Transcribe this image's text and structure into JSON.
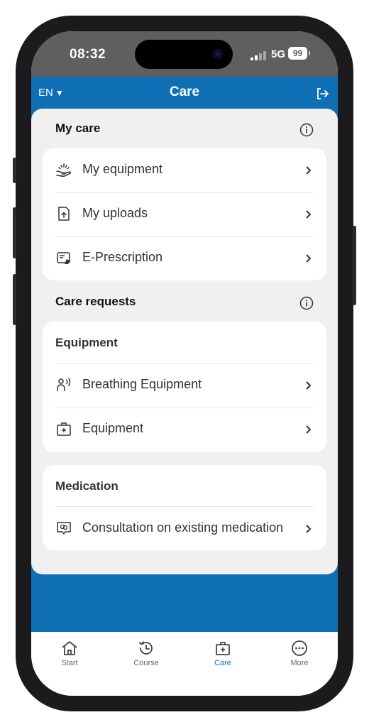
{
  "status_bar": {
    "time": "08:32",
    "network": "5G",
    "battery": "99"
  },
  "app_bar": {
    "language": "EN",
    "title": "Care"
  },
  "my_care": {
    "heading": "My care",
    "items": [
      {
        "label": "My equipment",
        "icon": "hand-holding-icon"
      },
      {
        "label": "My uploads",
        "icon": "file-upload-icon"
      },
      {
        "label": "E-Prescription",
        "icon": "prescription-icon"
      }
    ]
  },
  "care_requests": {
    "heading": "Care requests",
    "equipment": {
      "heading": "Equipment",
      "items": [
        {
          "label": "Breathing Equipment",
          "icon": "breathing-icon"
        },
        {
          "label": "Equipment",
          "icon": "medical-kit-icon"
        }
      ]
    },
    "medication": {
      "heading": "Medication",
      "items": [
        {
          "label": "Consultation on existing medication",
          "icon": "pill-chat-icon"
        }
      ]
    }
  },
  "tab_bar": {
    "tabs": [
      {
        "label": "Start",
        "icon": "home-icon"
      },
      {
        "label": "Course",
        "icon": "history-icon"
      },
      {
        "label": "Care",
        "icon": "medical-kit-icon"
      },
      {
        "label": "More",
        "icon": "more-icon"
      }
    ],
    "active": "Care"
  },
  "colors": {
    "primary": "#0f6fb5",
    "background": "#f0f0f0",
    "status_bar": "#5f5f5f"
  }
}
